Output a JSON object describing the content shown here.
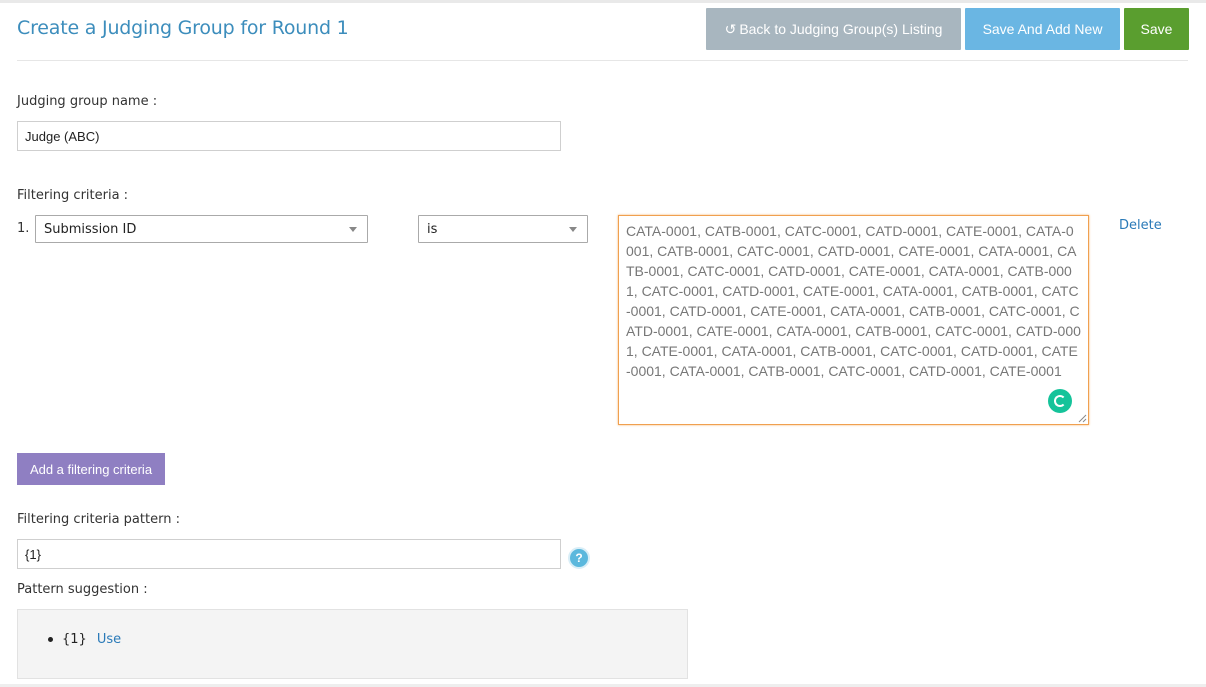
{
  "header": {
    "title": "Create a Judging Group for Round 1",
    "back_label": "Back to Judging Group(s) Listing",
    "save_add_new_label": "Save And Add New",
    "save_label": "Save",
    "colors": {
      "title": "#3c8dbc",
      "back": "#a8b6bf",
      "save_add_new": "#6ab6e3",
      "save": "#5a9e2f"
    }
  },
  "group_name": {
    "label": "Judging group name :",
    "value": "Judge (ABC)"
  },
  "filtering": {
    "label": "Filtering criteria :",
    "rows": [
      {
        "number": "1.",
        "field": "Submission ID",
        "operator": "is",
        "value": "CATA-0001, CATB-0001, CATC-0001, CATD-0001, CATE-0001, CATA-0001, CATB-0001, CATC-0001, CATD-0001, CATE-0001, CATA-0001, CATB-0001, CATC-0001, CATD-0001, CATE-0001, CATA-0001, CATB-0001, CATC-0001, CATD-0001, CATE-0001, CATA-0001, CATB-0001, CATC-0001, CATD-0001, CATE-0001, CATA-0001, CATB-0001, CATC-0001, CATD-0001, CATE-0001, CATA-0001, CATB-0001, CATC-0001, CATD-0001, CATE-0001, CATA-0001, CATB-0001, CATC-0001, CATD-0001, CATE-0001, CATA-0001, CATB-0001, CATC-0001, CATD-0001, CATE-0001",
        "delete_label": "Delete"
      }
    ],
    "add_label": "Add a filtering criteria",
    "add_color": "#8f7fc2"
  },
  "pattern": {
    "label": "Filtering criteria pattern :",
    "value": "{1}",
    "help_glyph": "?"
  },
  "suggestion": {
    "label": "Pattern suggestion :",
    "items": [
      {
        "pattern": "{1}",
        "use_label": "Use"
      }
    ]
  }
}
